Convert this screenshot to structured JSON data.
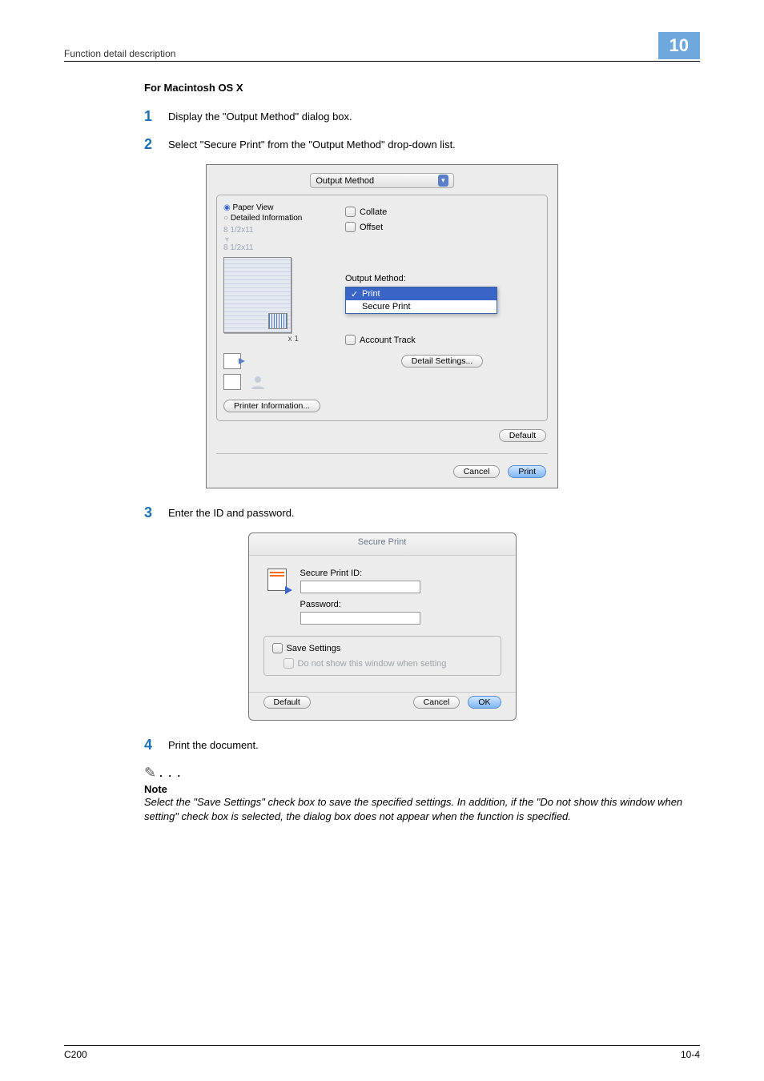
{
  "header": {
    "section": "Function detail description",
    "chapter": "10"
  },
  "subheading": "For Macintosh OS X",
  "steps": {
    "s1": {
      "num": "1",
      "text": "Display the \"Output Method\" dialog box."
    },
    "s2": {
      "num": "2",
      "text": "Select \"Secure Print\" from the \"Output Method\" drop-down list."
    },
    "s3": {
      "num": "3",
      "text": "Enter the ID and password."
    },
    "s4": {
      "num": "4",
      "text": "Print the document."
    }
  },
  "dialog1": {
    "tab": "Output Method",
    "radio_paper": "Paper View",
    "radio_detail": "Detailed Information",
    "size_top": "8 1/2x11",
    "size_bottom": "8 1/2x11",
    "x1": "x 1",
    "printer_info_btn": "Printer Information...",
    "collate": "Collate",
    "offset": "Offset",
    "output_method_label": "Output Method:",
    "dd_print": "Print",
    "dd_secure": "Secure Print",
    "account_track": "Account Track",
    "detail_settings_btn": "Detail Settings...",
    "default_btn": "Default",
    "cancel_btn": "Cancel",
    "print_btn": "Print"
  },
  "dialog2": {
    "title": "Secure Print",
    "sp_id_label": "Secure Print ID:",
    "pw_label": "Password:",
    "save_settings": "Save Settings",
    "do_not_show": "Do not show this window when setting",
    "default_btn": "Default",
    "cancel_btn": "Cancel",
    "ok_btn": "OK"
  },
  "note": {
    "heading": "Note",
    "body": "Select the \"Save Settings\" check box to save the specified settings. In addition, if the \"Do not show this window when setting\" check box is selected, the dialog box does not appear when the function is specified."
  },
  "footer": {
    "model": "C200",
    "page": "10-4"
  }
}
